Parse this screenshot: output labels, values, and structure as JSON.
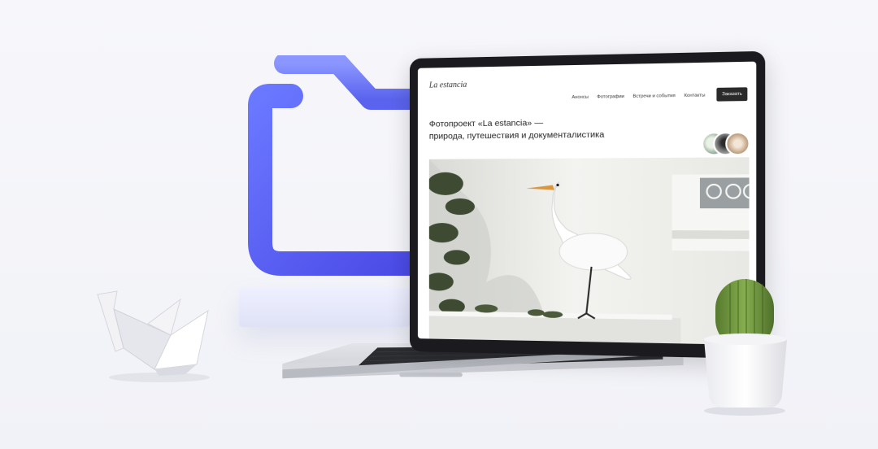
{
  "site": {
    "logo": "La estancia",
    "nav": [
      {
        "label": "Анонсы"
      },
      {
        "label": "Фотографии"
      },
      {
        "label": "Встречи и события"
      },
      {
        "label": "Контакты"
      }
    ],
    "order_button": "Заказать",
    "headline_line1": "Фотопроект «La estancia» —",
    "headline_line2": "природа, путешествия и документалистика"
  },
  "colors": {
    "folder_blue": "#4f5ff0",
    "button_dark": "#2a2a2a",
    "cactus_green": "#6f9a3e",
    "background": "#f4f5f9"
  },
  "icons": {
    "folder": "folder-icon",
    "origami": "origami-crane",
    "cactus": "cactus-plant"
  }
}
